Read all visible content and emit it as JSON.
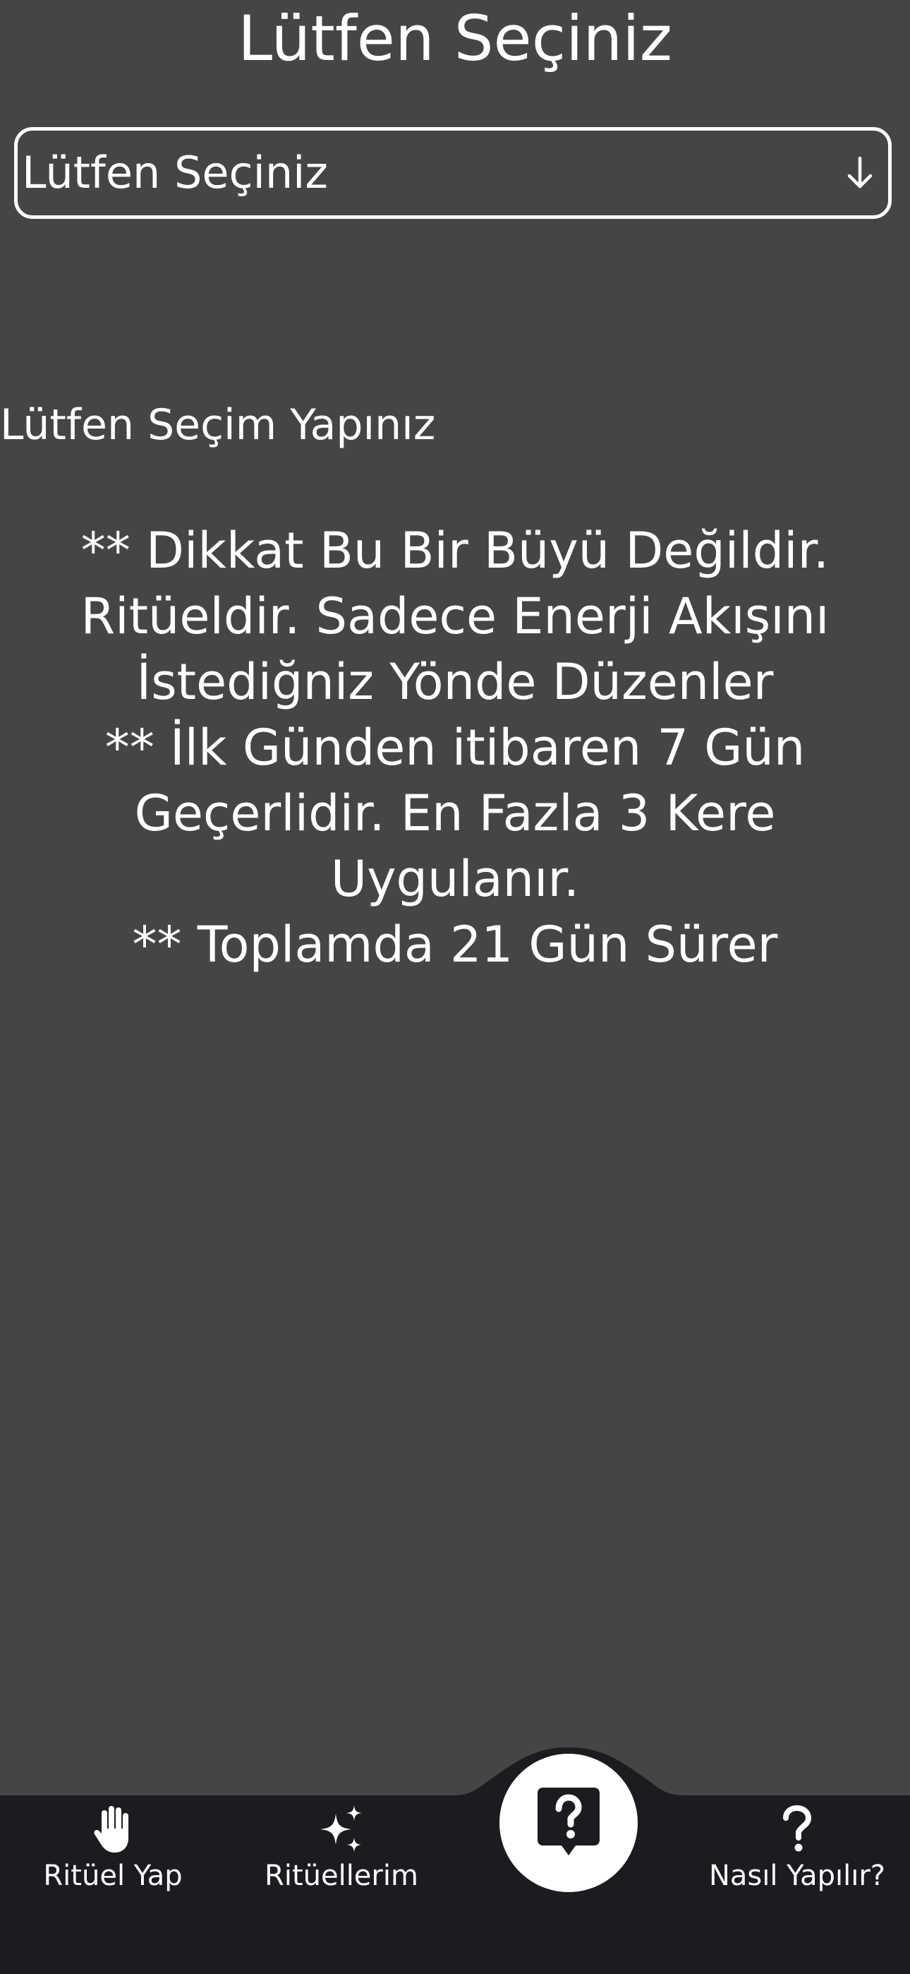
{
  "header": {
    "title": "Lütfen Seçiniz"
  },
  "selector": {
    "value": "Lütfen Seçiniz",
    "arrow_icon": "arrow-down-icon"
  },
  "content": {
    "prompt": "Lütfen Seçim Yapınız",
    "info_lines": [
      "** Dikkat Bu Bir Büyü Değildir.",
      "Ritüeldir. Sadece Enerji Akışını",
      "İstediğniz Yönde Düzenler",
      "** İlk Günden itibaren 7 Gün",
      "Geçerlidir. En Fazla 3 Kere",
      "Uygulanır.",
      "** Toplamda 21 Gün Sürer"
    ]
  },
  "tab_bar": {
    "items": [
      {
        "label": "Ritüel Yap",
        "icon": "raised-hand-icon"
      },
      {
        "label": "Ritüellerim",
        "icon": "sparkles-icon"
      },
      {
        "label": "Nasıl Yapılır?",
        "icon": "question-mark-icon"
      }
    ],
    "center_button": {
      "icon": "question-bubble-icon"
    }
  },
  "colors": {
    "background": "#454545",
    "tab_bar": "#1c1b20",
    "text": "#ffffff",
    "center_button": "#ffffff"
  }
}
